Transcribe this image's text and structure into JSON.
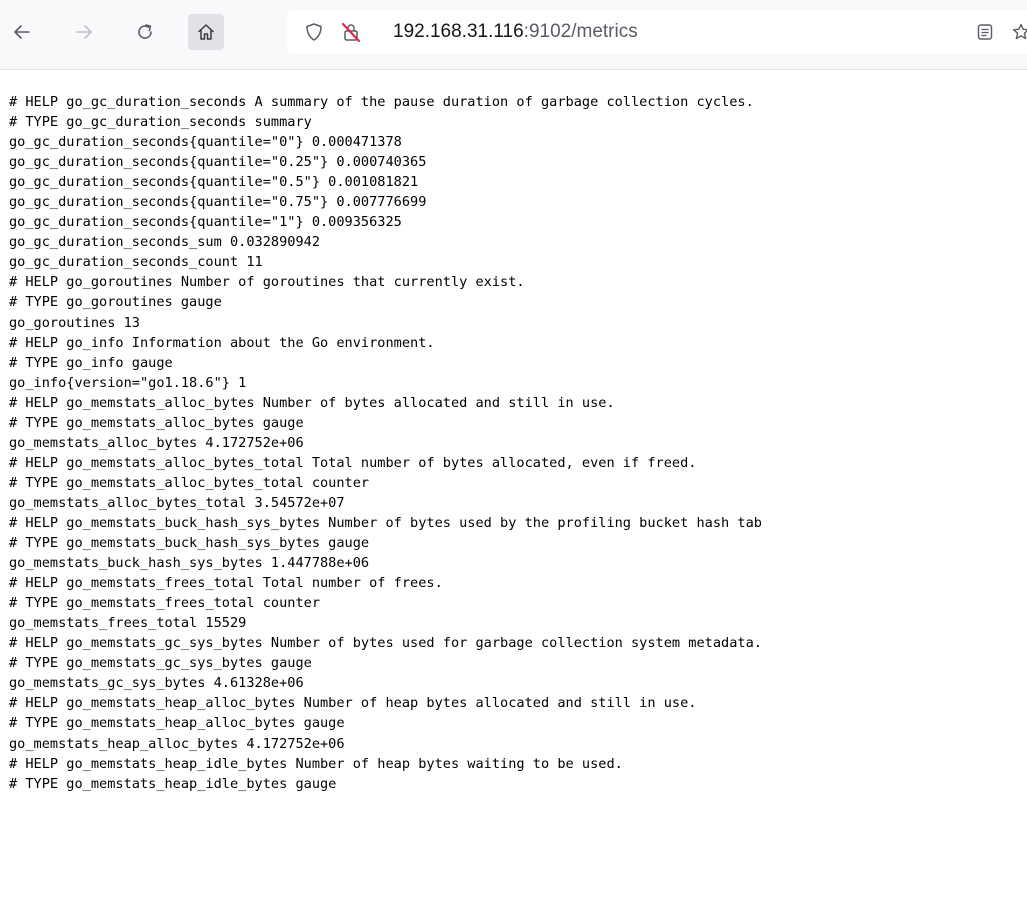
{
  "toolbar": {
    "icons": {
      "back": "back-arrow-icon",
      "forward": "forward-arrow-icon",
      "reload": "reload-icon",
      "home": "home-icon",
      "tracking": "tracking-protection-shield-icon",
      "security": "insecure-connection-icon",
      "reader": "reader-view-icon",
      "bookmark": "bookmark-star-icon"
    },
    "colors": {
      "insecure": "#e22850",
      "icon": "#5b5b66",
      "disabled_icon": "#bfbfc9"
    }
  },
  "urlbar": {
    "host": "192.168.31.116",
    "path": ":9102/metrics"
  },
  "metrics_lines": [
    "# HELP go_gc_duration_seconds A summary of the pause duration of garbage collection cycles.",
    "# TYPE go_gc_duration_seconds summary",
    "go_gc_duration_seconds{quantile=\"0\"} 0.000471378",
    "go_gc_duration_seconds{quantile=\"0.25\"} 0.000740365",
    "go_gc_duration_seconds{quantile=\"0.5\"} 0.001081821",
    "go_gc_duration_seconds{quantile=\"0.75\"} 0.007776699",
    "go_gc_duration_seconds{quantile=\"1\"} 0.009356325",
    "go_gc_duration_seconds_sum 0.032890942",
    "go_gc_duration_seconds_count 11",
    "# HELP go_goroutines Number of goroutines that currently exist.",
    "# TYPE go_goroutines gauge",
    "go_goroutines 13",
    "# HELP go_info Information about the Go environment.",
    "# TYPE go_info gauge",
    "go_info{version=\"go1.18.6\"} 1",
    "# HELP go_memstats_alloc_bytes Number of bytes allocated and still in use.",
    "# TYPE go_memstats_alloc_bytes gauge",
    "go_memstats_alloc_bytes 4.172752e+06",
    "# HELP go_memstats_alloc_bytes_total Total number of bytes allocated, even if freed.",
    "# TYPE go_memstats_alloc_bytes_total counter",
    "go_memstats_alloc_bytes_total 3.54572e+07",
    "# HELP go_memstats_buck_hash_sys_bytes Number of bytes used by the profiling bucket hash tab",
    "# TYPE go_memstats_buck_hash_sys_bytes gauge",
    "go_memstats_buck_hash_sys_bytes 1.447788e+06",
    "# HELP go_memstats_frees_total Total number of frees.",
    "# TYPE go_memstats_frees_total counter",
    "go_memstats_frees_total 15529",
    "# HELP go_memstats_gc_sys_bytes Number of bytes used for garbage collection system metadata.",
    "# TYPE go_memstats_gc_sys_bytes gauge",
    "go_memstats_gc_sys_bytes 4.61328e+06",
    "# HELP go_memstats_heap_alloc_bytes Number of heap bytes allocated and still in use.",
    "# TYPE go_memstats_heap_alloc_bytes gauge",
    "go_memstats_heap_alloc_bytes 4.172752e+06",
    "# HELP go_memstats_heap_idle_bytes Number of heap bytes waiting to be used.",
    "# TYPE go_memstats_heap_idle_bytes gauge"
  ]
}
